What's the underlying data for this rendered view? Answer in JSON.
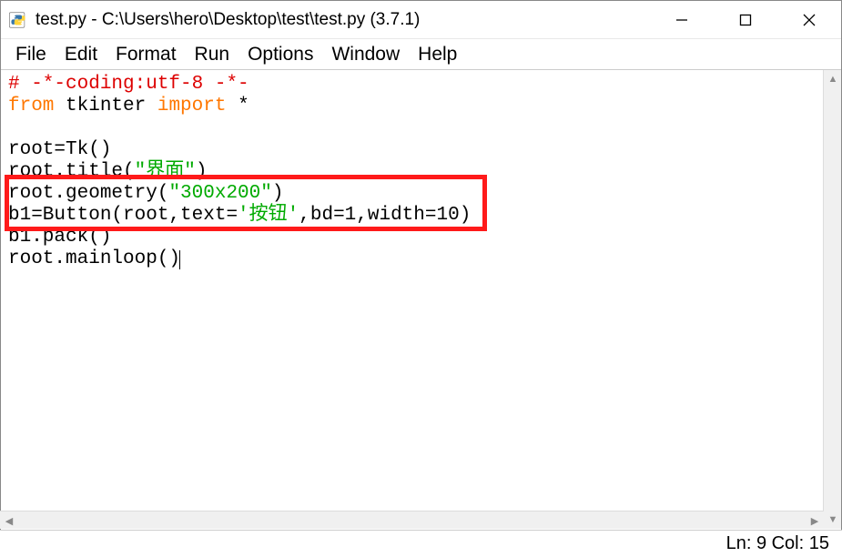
{
  "titlebar": {
    "title": "test.py - C:\\Users\\hero\\Desktop\\test\\test.py (3.7.1)"
  },
  "menu": {
    "items": [
      "File",
      "Edit",
      "Format",
      "Run",
      "Options",
      "Window",
      "Help"
    ]
  },
  "code": {
    "line1_comment": "# -*-coding:utf-8 -*-",
    "line2_kw1": "from",
    "line2_mod": " tkinter ",
    "line2_kw2": "import",
    "line2_rest": " *",
    "line3": "",
    "line4": "root=Tk()",
    "line5_a": "root.title(",
    "line5_str": "\"界面\"",
    "line5_b": ")",
    "line6_a": "root.geometry(",
    "line6_str": "\"300x200\"",
    "line6_b": ")",
    "line7_a": "b1=Button(root,text=",
    "line7_str": "'按钮'",
    "line7_b": ",bd=1,width=10)",
    "line8": "b1.pack()",
    "line9": "root.mainloop()"
  },
  "status": {
    "text": "Ln: 9  Col: 15"
  }
}
